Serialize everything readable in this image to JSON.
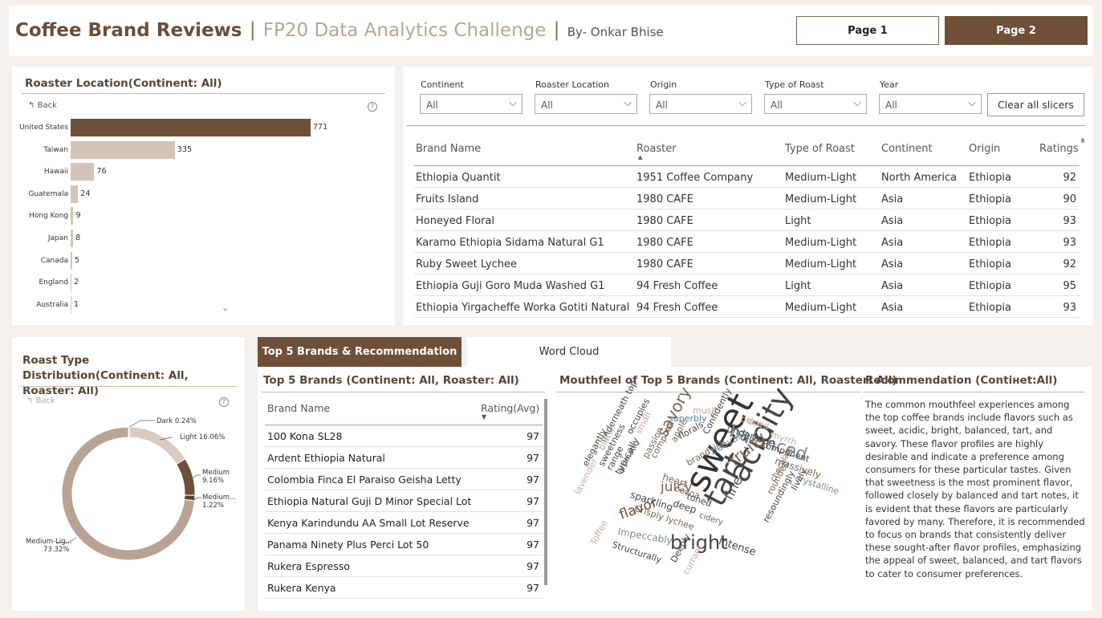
{
  "header": {
    "title": "Coffee Brand Reviews",
    "separator": "|",
    "subtitle": "FP20 Data Analytics Challenge",
    "author": "By- Onkar Bhise",
    "page1": "Page 1",
    "page2": "Page 2"
  },
  "roaster_location": {
    "title": "Roaster Location(Continent: All)",
    "back": "Back",
    "help": "?"
  },
  "chart_data": [
    {
      "type": "bar",
      "title": "Roaster Location(Continent: All)",
      "categories": [
        "United States",
        "Taiwan",
        "Hawaii",
        "Guatemala",
        "Hong Kong",
        "Japan",
        "Canada",
        "England",
        "Australia"
      ],
      "values": [
        771,
        335,
        76,
        24,
        9,
        8,
        5,
        2,
        1
      ],
      "colors": [
        "#6e4f38",
        "#d4c4b8",
        "#d4c4b8",
        "#d4c4b8",
        "#d4c4b8",
        "#d4c4b8",
        "#d4c4b8",
        "#d4c4b8",
        "#d4c4b8"
      ]
    },
    {
      "type": "pie",
      "title": "Roast Type Distribution(Continent: All, Roaster: All)",
      "categories": [
        "Dark",
        "Light",
        "Medium",
        "Medium-...",
        "Medium-Lig..."
      ],
      "values": [
        0.24,
        16.06,
        9.16,
        1.22,
        73.32
      ],
      "labels": [
        "Dark 0.24%",
        "Light 16.06%",
        "Medium 9.16%",
        "Medium... 1.22%",
        "Medium-Lig... 73.32%"
      ],
      "colors": [
        "#3d2b1e",
        "#d8cbc0",
        "#6e4f38",
        "#54402f",
        "#b8a394"
      ]
    }
  ],
  "slicers": {
    "items": [
      {
        "label": "Continent",
        "value": "All"
      },
      {
        "label": "Roaster Location",
        "value": "All"
      },
      {
        "label": "Origin",
        "value": "All"
      },
      {
        "label": "Type of Roast",
        "value": "All"
      },
      {
        "label": "Year",
        "value": "All"
      }
    ],
    "clear": "Clear all slicers"
  },
  "brand_table": {
    "columns": [
      "Brand Name",
      "Roaster",
      "Type of Roast",
      "Continent",
      "Origin",
      "Ratings"
    ],
    "rows": [
      [
        "Ethiopia Quantit",
        "1951 Coffee Company",
        "Medium-Light",
        "North America",
        "Ethiopia",
        "92"
      ],
      [
        "Fruits Island",
        "1980 CAFE",
        "Medium-Light",
        "Asia",
        "Ethiopia",
        "90"
      ],
      [
        "Honeyed Floral",
        "1980 CAFE",
        "Light",
        "Asia",
        "Ethiopia",
        "93"
      ],
      [
        "Karamo Ethiopia Sidama Natural G1",
        "1980 CAFE",
        "Medium-Light",
        "Asia",
        "Ethiopia",
        "93"
      ],
      [
        "Ruby Sweet Lychee",
        "1980 CAFE",
        "Medium-Light",
        "Asia",
        "Ethiopia",
        "92"
      ],
      [
        "Ethiopia Guji Goro Muda Washed G1",
        "94 Fresh Coffee",
        "Light",
        "Asia",
        "Ethiopia",
        "95"
      ],
      [
        "Ethiopia Yirgacheffe Worka Gotiti Natural",
        "94 Fresh Coffee",
        "Medium-Light",
        "Asia",
        "Ethiopia",
        "93"
      ]
    ]
  },
  "roast_type": {
    "title": "Roast Type Distribution(Continent: All, Roaster: All)",
    "back": "Back",
    "help": "?"
  },
  "tabs": {
    "active": "Top 5 Brands & Recommendation",
    "inactive": "Word Cloud"
  },
  "top5": {
    "title": "Top 5 Brands (Continent: All, Roaster: All)",
    "col_brand": "Brand Name",
    "col_rating": "Rating(Avg)",
    "rows": [
      [
        "100 Kona SL28",
        "97"
      ],
      [
        "Ardent Ethiopia Natural",
        "97"
      ],
      [
        "Colombia Finca El Paraiso Geisha Letty",
        "97"
      ],
      [
        "Ethiopia Natural Guji D Minor Special Lot",
        "97"
      ],
      [
        "Kenya Karindundu AA Small Lot Reserve",
        "97"
      ],
      [
        "Panama Ninety Plus Perci Lot 50",
        "97"
      ],
      [
        "Rukera Espresso",
        "97"
      ],
      [
        "Rukera Kenya",
        "97"
      ]
    ]
  },
  "mouthfeel": {
    "title": "Mouthfeel of Top 5 Brands (Continent: All, Roaster: All)"
  },
  "recommendation": {
    "title": "Recommendation (Contінet:All)",
    "text": "The common mouthfeel experiences among the top coffee brands include flavors such as sweet, acidic, bright, balanced, tart, and savory. These flavor profiles are highly desirable and indicate a preference among consumers for these particular tastes. Given that sweetness is the most prominent flavor, followed closely by balanced and tart notes, it is evident that these flavors are particularly favored by many. Therefore, it is recommended to focus on brands that consistently deliver these sought-after flavor profiles, emphasizing the appeal of sweet, balanced, and tart flavors to cater to consumer preferences."
  },
  "word_cloud": {
    "words": [
      "sweet",
      "acidity",
      "tart",
      "balanced",
      "bright",
      "fruity",
      "savory",
      "juicy",
      "flavor",
      "intense",
      "Structurally",
      "Impeccably",
      "Crisply lychee",
      "deep",
      "cocoa",
      "heart",
      "sparkling",
      "typically",
      "range",
      "sweetness",
      "elegantly",
      "underneath top",
      "occupies",
      "passion",
      "compote",
      "apple",
      "florals",
      "brandyish",
      "buoyant",
      "undertone",
      "component",
      "massively",
      "crystalline",
      "rounded",
      "chocolate",
      "lively",
      "resoundingly",
      "toned",
      "cidery",
      "superbly",
      "musk",
      "Confidently",
      "dried",
      "myrrh",
      "lavender",
      "black",
      "small",
      "aromatic",
      "Toffee",
      "Deeply",
      "currant",
      "plum",
      "fine"
    ]
  }
}
